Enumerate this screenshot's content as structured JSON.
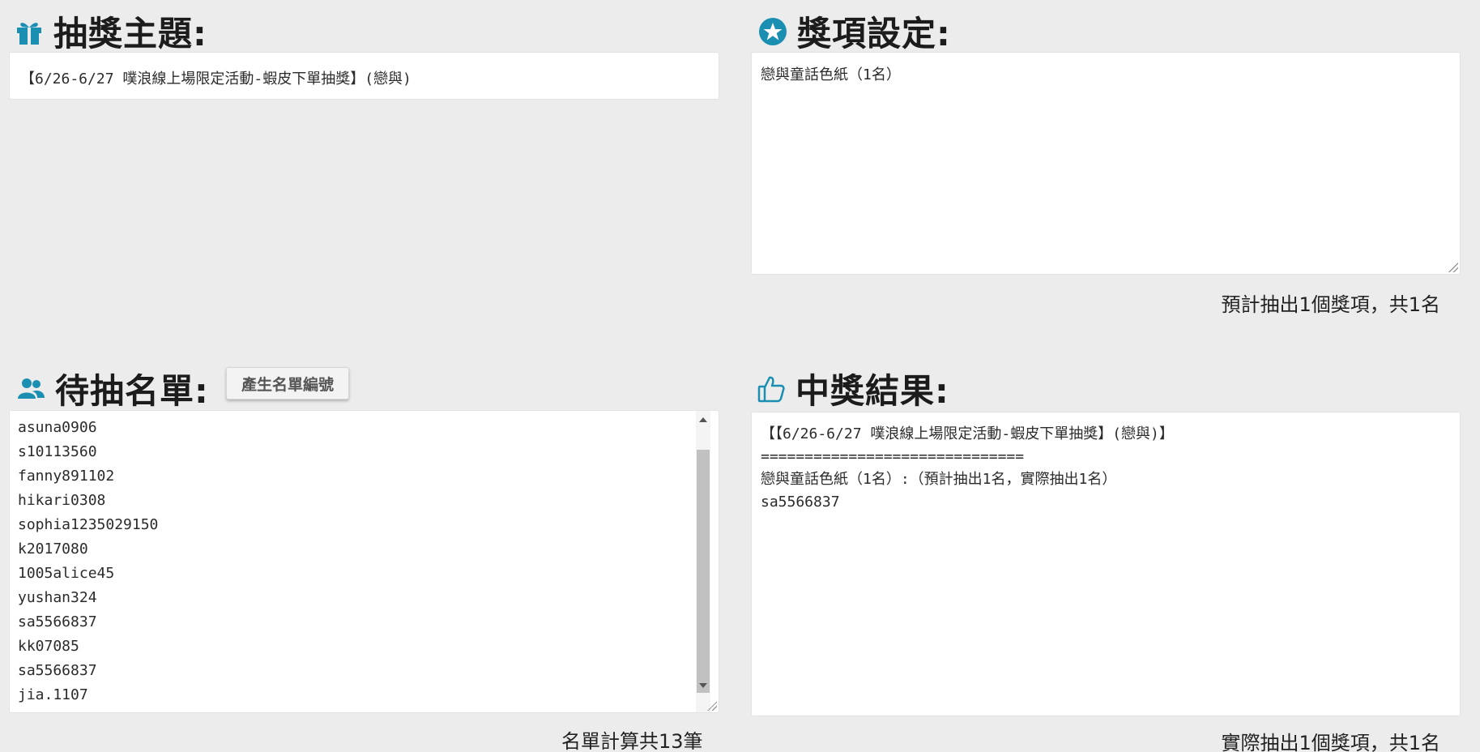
{
  "accent_color": "#1a8fb1",
  "theme_section": {
    "title": "抽獎主題:",
    "icon": "gift-icon",
    "value": "【6/26-6/27 噗浪線上場限定活動-蝦皮下單抽獎】(戀與)"
  },
  "prize_section": {
    "title": "獎項設定:",
    "icon": "star-icon",
    "value": "戀與童話色紙（1名）",
    "summary": "預計抽出1個獎項，共1名"
  },
  "names_section": {
    "title": "待抽名單:",
    "icon": "users-icon",
    "button_label": "產生名單編號",
    "names": [
      "asuna0906",
      "s10113560",
      "fanny891102",
      "hikari0308",
      "sophia1235029150",
      "k2017080",
      "1005alice45",
      "yushan324",
      "sa5566837",
      "kk07085",
      "sa5566837",
      "jia.1107"
    ],
    "summary": "名單計算共13筆"
  },
  "result_section": {
    "title": "中獎結果:",
    "icon": "thumbs-up-icon",
    "lines": [
      "【【6/26-6/27 噗浪線上場限定活動-蝦皮下單抽獎】(戀與)】",
      "==============================",
      "戀與童話色紙（1名）:（預計抽出1名，實際抽出1名）",
      "sa5566837"
    ],
    "summary": "實際抽出1個獎項，共1名"
  }
}
